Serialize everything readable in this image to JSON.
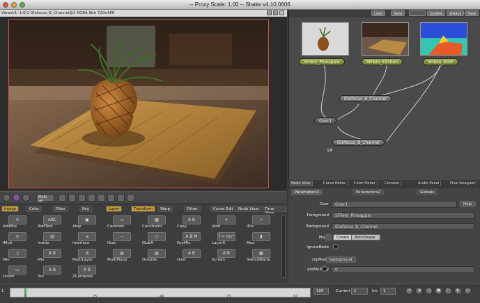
{
  "window": {
    "title": "-- Proxy Scale: 1.00 -- Shake v4.10.0606"
  },
  "viewer": {
    "header": "Viewer1: 1.0/1 IDefocus_B_Channel@1 RGBA 8bit 720x486",
    "tools": {
      "mode_button": "Multi off"
    }
  },
  "tool_tabs": [
    "Image",
    "Color",
    "Filter",
    "Key",
    "Layer",
    "Transform",
    "Warp",
    "Other",
    "Curve Edit",
    "Node View",
    "Time View"
  ],
  "tools": [
    {
      "label": "AddMix",
      "icon": "addmix-icon",
      "glyph": "✕"
    },
    {
      "label": "AddText",
      "icon": "addtext-icon",
      "glyph": "ABC"
    },
    {
      "label": "Atop",
      "icon": "atop-icon",
      "glyph": "▣"
    },
    {
      "label": "Common",
      "icon": "common-icon",
      "glyph": "▭"
    },
    {
      "label": "Constraint",
      "icon": "constraint-icon",
      "glyph": "▦"
    },
    {
      "label": "Copy",
      "icon": "copy-icon",
      "glyph": "A B"
    },
    {
      "label": "IAdd",
      "icon": "iadd-icon",
      "glyph": "+"
    },
    {
      "label": "IDiv",
      "icon": "idiv-icon",
      "glyph": "÷"
    },
    {
      "label": "IMult",
      "icon": "imult-icon",
      "glyph": "✕"
    },
    {
      "label": "Inside",
      "icon": "inside-icon",
      "glyph": "▥"
    },
    {
      "label": "Interlace",
      "icon": "interlace-icon",
      "glyph": "≡"
    },
    {
      "label": "ISub",
      "icon": "isub-icon",
      "glyph": "−"
    },
    {
      "label": "ISubA",
      "icon": "isuba-icon",
      "glyph": "□"
    },
    {
      "label": "KeyMix",
      "icon": "keymix-icon",
      "glyph": "A B M"
    },
    {
      "label": "LayerX",
      "icon": "layerx-icon",
      "glyph": "f = mc²"
    },
    {
      "label": "Max",
      "icon": "max-icon",
      "glyph": "▮"
    },
    {
      "label": "Min",
      "icon": "min-icon",
      "glyph": "▯"
    },
    {
      "label": "Mix",
      "icon": "mix-icon",
      "glyph": "A B"
    },
    {
      "label": "MultiLayer",
      "icon": "multilayer-icon",
      "glyph": "≣"
    },
    {
      "label": "MultiPlane",
      "icon": "multiplane-icon",
      "glyph": "▤"
    },
    {
      "label": "Outside",
      "icon": "outside-icon",
      "glyph": "▧"
    },
    {
      "label": "Over",
      "icon": "over-icon",
      "glyph": "A B"
    },
    {
      "label": "Screen",
      "icon": "screen-icon",
      "glyph": "A B"
    },
    {
      "label": "SwitchMatte",
      "icon": "switchmatte-icon",
      "glyph": "▩"
    },
    {
      "label": "Under",
      "icon": "under-icon",
      "glyph": "▭"
    },
    {
      "label": "Xor",
      "icon": "xor-icon",
      "glyph": "A B"
    },
    {
      "label": "ZCompose",
      "icon": "zcompose-icon",
      "glyph": "A B"
    }
  ],
  "timeline": {
    "ticks": [
      "1",
      "25",
      "49",
      "73",
      "97"
    ],
    "end_frame": "100",
    "current_label": "Current",
    "current_value": "1",
    "inc_label": "Inc",
    "inc_value": "1",
    "start_value": "1"
  },
  "node_view": {
    "buttons": [
      "Load",
      "Save",
      "Update",
      "always",
      "Base"
    ],
    "nodes": {
      "file1": "SFileIn_Pineapple",
      "file2": "SFileIn_Kitchen",
      "file3": "SFileIn_IDOF",
      "defocus_top": "IDefocus_B_Channel",
      "over": "Over1",
      "defocus_bottom": "IDefocus_B_Channel"
    },
    "caption": "1A"
  },
  "panel_tabs": [
    "Node View",
    "Curve Editor",
    "Color Picker",
    "Console",
    "Audio Panel",
    "Pixel Analyzer"
  ],
  "params": {
    "tabs": [
      "Parameters1",
      "Parameters2",
      "Globals"
    ],
    "help": "Help",
    "rows": {
      "over_label": "Over",
      "over_value": "Over1",
      "fg_label": "Foreground",
      "fg_value": "SFileIn_Pineapple",
      "bg_label": "Background",
      "bg_value": "IDefocus_B_Channel",
      "mask_label": "Mask",
      "mask_create": "Create",
      "mask_shape": "RotoShape",
      "ignore_label": "ignoreNode",
      "clip_label": "clipMode",
      "clip_value": "background",
      "premult_label": "preMultiply",
      "premult_value": "0"
    }
  },
  "colors": {
    "accent": "#c69a3d",
    "file_node": "#8a9c40",
    "viewer_border": "#cc5555"
  }
}
